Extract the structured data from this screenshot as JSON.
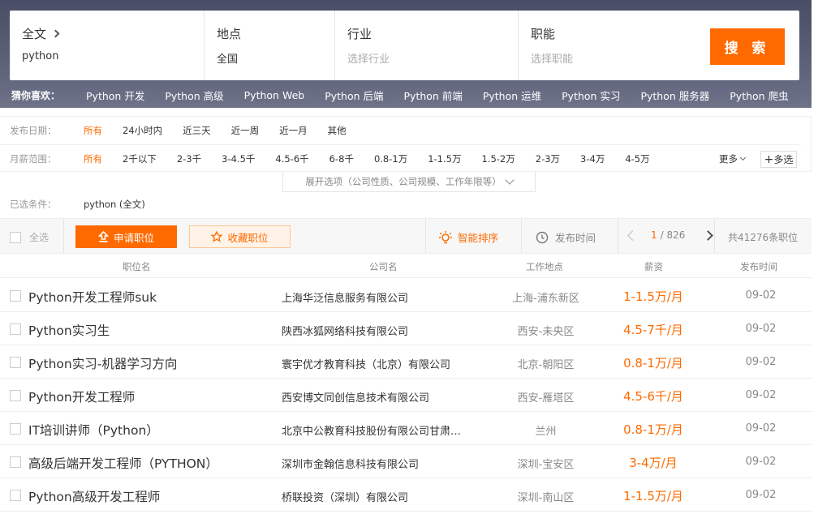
{
  "search": {
    "fulltext_label": "全文",
    "fulltext_value": "python",
    "location_label": "地点",
    "location_value": "全国",
    "industry_label": "行业",
    "industry_placeholder": "选择行业",
    "function_label": "职能",
    "function_placeholder": "选择职能",
    "search_button": "搜 索"
  },
  "guess": {
    "label": "猜你喜欢：",
    "items": [
      "Python 开发",
      "Python 高级",
      "Python Web",
      "Python 后端",
      "Python 前端",
      "Python 运维",
      "Python 实习",
      "Python 服务器",
      "Python 爬虫"
    ]
  },
  "filters": {
    "date_label": "发布日期：",
    "date_options": [
      "所有",
      "24小时内",
      "近三天",
      "近一周",
      "近一月",
      "其他"
    ],
    "salary_label": "月薪范围：",
    "salary_options": [
      "所有",
      "2千以下",
      "2-3千",
      "3-4.5千",
      "4.5-6千",
      "6-8千",
      "0.8-1万",
      "1-1.5万",
      "1.5-2万",
      "2-3万",
      "3-4万",
      "4-5万"
    ],
    "more": "更多",
    "multi": "多选",
    "expand": "展开选项（公司性质、公司规模、工作年限等）",
    "chosen_label": "已选条件：",
    "chosen_value": "python (全文)"
  },
  "toolbar": {
    "select_all": "全选",
    "apply": "申请职位",
    "favorite": "收藏职位",
    "smart_sort": "智能排序",
    "time_sort": "发布时间",
    "page_current": "1",
    "page_total": "/ 826",
    "total_count": "共41276条职位"
  },
  "table": {
    "headers": {
      "title": "职位名",
      "company": "公司名",
      "location": "工作地点",
      "salary": "薪资",
      "date": "发布时间"
    },
    "rows": [
      {
        "title": "Python开发工程师suk",
        "company": "上海华泛信息服务有限公司",
        "location": "上海-浦东新区",
        "salary": "1-1.5万/月",
        "date": "09-02"
      },
      {
        "title": "Python实习生",
        "company": "陕西冰狐网络科技有限公司",
        "location": "西安-未央区",
        "salary": "4.5-7千/月",
        "date": "09-02"
      },
      {
        "title": "Python实习-机器学习方向",
        "company": "寰宇优才教育科技（北京）有限公司",
        "location": "北京-朝阳区",
        "salary": "0.8-1万/月",
        "date": "09-02"
      },
      {
        "title": "Python开发工程师",
        "company": "西安博文同创信息技术有限公司",
        "location": "西安-雁塔区",
        "salary": "4.5-6千/月",
        "date": "09-02"
      },
      {
        "title": "IT培训讲师（Python）",
        "company": "北京中公教育科技股份有限公司甘肃…",
        "location": "兰州",
        "salary": "0.8-1万/月",
        "date": "09-02"
      },
      {
        "title": "高级后端开发工程师（PYTHON）",
        "company": "深圳市金翰信息科技有限公司",
        "location": "深圳-宝安区",
        "salary": "3-4万/月",
        "date": "09-02"
      },
      {
        "title": "Python高级开发工程师",
        "company": "桥联投资（深圳）有限公司",
        "location": "深圳-南山区",
        "salary": "1-1.5万/月",
        "date": "09-02"
      }
    ]
  },
  "colors": {
    "accent": "#ff6a00",
    "header_bg": "#5d6179"
  }
}
